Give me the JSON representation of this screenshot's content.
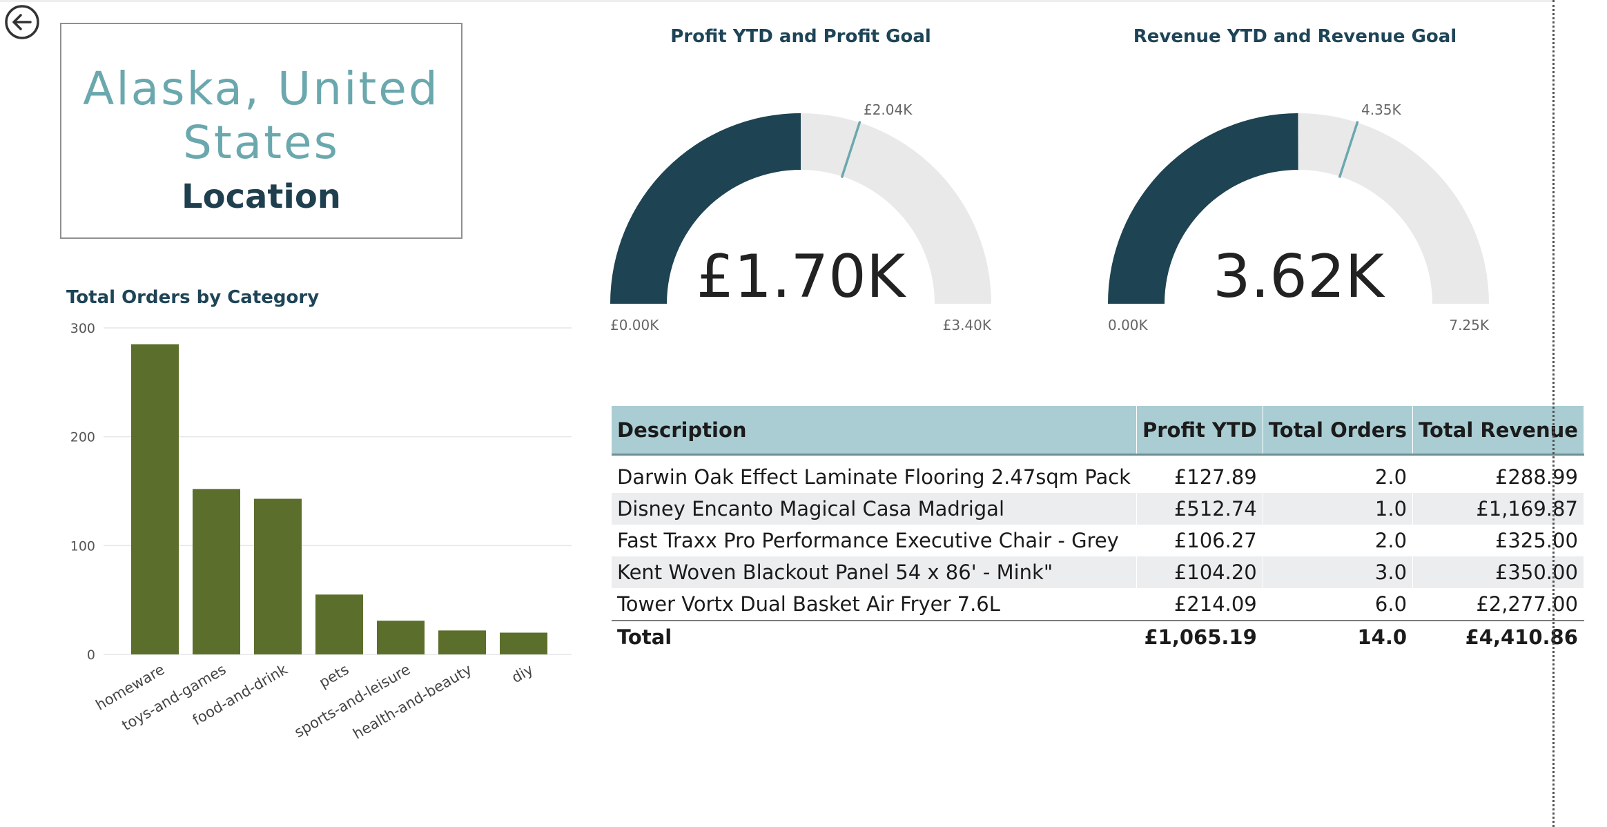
{
  "location": {
    "name": "Alaska, United States",
    "label": "Location"
  },
  "bar_chart": {
    "title": "Total Orders by Category"
  },
  "profit_gauge": {
    "title": "Profit YTD and Profit Goal",
    "value_label": "£1.70K",
    "min_label": "£0.00K",
    "max_label": "£3.40K",
    "target_label": "£2.04K",
    "value": 1.7,
    "min": 0,
    "max": 3.4,
    "target": 2.04
  },
  "revenue_gauge": {
    "title": "Revenue YTD and Revenue Goal",
    "value_label": "3.62K",
    "min_label": "0.00K",
    "max_label": "7.25K",
    "target_label": "4.35K",
    "value": 3.62,
    "min": 0,
    "max": 7.25,
    "target": 4.35
  },
  "table": {
    "columns": [
      "Description",
      "Profit YTD",
      "Total Orders",
      "Total Revenue"
    ],
    "rows": [
      [
        "Darwin Oak Effect Laminate Flooring 2.47sqm Pack",
        "£127.89",
        "2.0",
        "£288.99"
      ],
      [
        "Disney Encanto Magical Casa Madrigal",
        "£512.74",
        "1.0",
        "£1,169.87"
      ],
      [
        "Fast Traxx Pro Performance Executive Chair - Grey",
        "£106.27",
        "2.0",
        "£325.00"
      ],
      [
        "Kent Woven Blackout Panel 54 x 86' - Mink\"",
        "£104.20",
        "3.0",
        "£350.00"
      ],
      [
        "Tower Vortx Dual Basket Air Fryer 7.6L",
        "£214.09",
        "6.0",
        "£2,277.00"
      ]
    ],
    "total": [
      "Total",
      "£1,065.19",
      "14.0",
      "£4,410.86"
    ]
  },
  "colors": {
    "gauge_fill": "#1e4352",
    "gauge_track": "#e9e9e9",
    "gauge_target": "#6aa8ae",
    "bar": "#5c6e2b",
    "title_text": "#1e4457",
    "location_text": "#6aa8ae",
    "table_header": "#a9cdd3"
  },
  "icons": {
    "back": "back-arrow-circle-icon"
  },
  "chart_data": [
    {
      "type": "bar",
      "title": "Total Orders by Category",
      "categories": [
        "homeware",
        "toys-and-games",
        "food-and-drink",
        "pets",
        "sports-and-leisure",
        "health-and-beauty",
        "diy"
      ],
      "values": [
        285,
        152,
        143,
        55,
        31,
        22,
        20
      ],
      "ylim": [
        0,
        300
      ],
      "yticks": [
        0,
        100,
        200,
        300
      ],
      "grid": true
    }
  ]
}
